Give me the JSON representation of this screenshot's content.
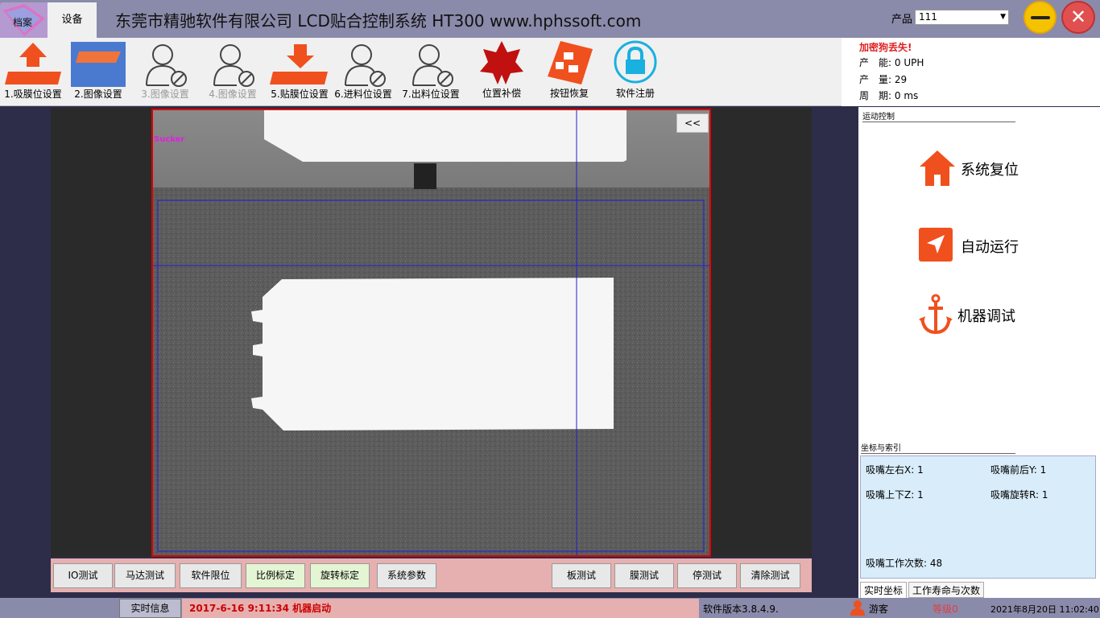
{
  "app": {
    "logo_label": "档案",
    "tab_device": "设备",
    "title": "东莞市精驰软件有限公司 LCD贴合控制系统 HT300 www.hphssoft.com",
    "product_label": "产品",
    "product_value": "111"
  },
  "toolbar": {
    "buttons": [
      {
        "label": "1.吸膜位设置",
        "icon": "arrow-up-icon"
      },
      {
        "label": "2.图像设置",
        "icon": "image-setting-icon"
      },
      {
        "label": "3.图像设置",
        "icon": "user-disabled-icon"
      },
      {
        "label": "4.图像设置",
        "icon": "user-disabled-icon"
      },
      {
        "label": "5.贴膜位设置",
        "icon": "arrow-down-icon"
      },
      {
        "label": "6.进料位设置",
        "icon": "user-disabled-icon"
      },
      {
        "label": "7.出料位设置",
        "icon": "user-disabled-icon"
      },
      {
        "label": "位置补偿",
        "icon": "star-icon"
      },
      {
        "label": "按钮恢复",
        "icon": "restore-icon"
      },
      {
        "label": "软件注册",
        "icon": "lock-icon"
      }
    ]
  },
  "status": {
    "warning": "加密狗丢失!",
    "capacity_label": "产　能:",
    "capacity_value": "0 UPH",
    "output_label": "产　量:",
    "output_value": "29",
    "cycle_label": "周　期:",
    "cycle_value": "0 ms"
  },
  "camera": {
    "collapse": "<<",
    "overlay_label": "Sucker"
  },
  "bottom_buttons": [
    {
      "label": "IO测试"
    },
    {
      "label": "马达测试"
    },
    {
      "label": "软件限位"
    },
    {
      "label": "比例标定"
    },
    {
      "label": "旋转标定"
    },
    {
      "label": "系统参数"
    },
    {
      "label": "板测试"
    },
    {
      "label": "膜测试"
    },
    {
      "label": "停测试"
    },
    {
      "label": "清除测试"
    }
  ],
  "right_panel": {
    "motion_title": "运动控制",
    "reset": "系统复位",
    "auto_run": "自动运行",
    "debug": "机器调试",
    "coord_title": "坐标与索引",
    "coords": {
      "x": "吸嘴左右X:  1",
      "y": "吸嘴前后Y:  1",
      "z": "吸嘴上下Z:  1",
      "r": "吸嘴旋转R:  1",
      "count": "吸嘴工作次数:  48"
    },
    "tab_realtime": "实时坐标",
    "tab_life": "工作寿命与次数"
  },
  "statusbar": {
    "info_button": "实时信息",
    "message": "2017-6-16 9:11:34 机器启动",
    "version": "软件版本3.8.4.9.",
    "user": "游客",
    "level": "等级0",
    "time": "2021年8月20日 11:02:40"
  },
  "colors": {
    "accent_orange": "#f0501e",
    "title_bar": "#8a8aaa",
    "camera_border": "#e00000",
    "coord_bg": "#d8ecfa",
    "lock_cyan": "#1ab0e0"
  }
}
